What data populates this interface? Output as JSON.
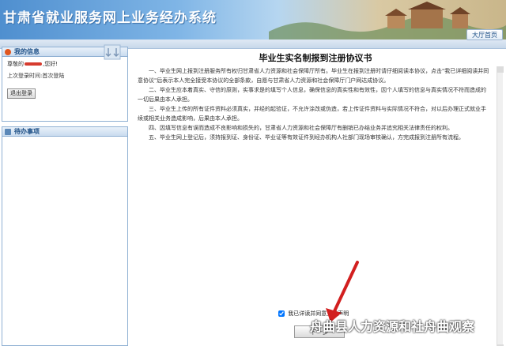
{
  "header": {
    "title": "甘肃省就业服务网上业务经办系统",
    "hall_button": "大厅首页"
  },
  "info_panel": {
    "title": "我的信息",
    "greeting_prefix": "尊敬的",
    "greeting_suffix": ",您好!",
    "last_login_label": "上次登录时间:首次登陆",
    "logout_button": "退出登录"
  },
  "todo_panel": {
    "title": "待办事项"
  },
  "agreement": {
    "title": "毕业生实名制报到注册协议书",
    "paragraphs": [
      "一、毕业生网上报到注册服务所有权归甘肃省人力资源和社会保障厅所有。毕业生在报到注册时请仔细阅读本协议，点击\"我已详细阅读并同意协议\"后表示本人完全接受本协议的全部条款，自愿与甘肃省人力资源和社会保障厅门户网达成协议。",
      "二、毕业生应本着真实、守信的原则，实事求是的填写个人信息，确保信息的真实性和有效性，因个人填写的信息与真实情况不符而造成的一切后果由本人承担。",
      "三、毕业生上传的所有证件资料必须真实，并经的起验证，不允许涂改或伪造，若上传证件资料与实际情况不符合，对以后办理正式就业手续或相关业务造成影响，后果由本人承担。",
      "四、因填写信息有误而造成不良影响和损失的，甘肃省人力资源和社会保障厅有删销已办结业务并追究相关法律责任的权利。",
      "五、毕业生网上登记后，须持报到证、身份证、毕业证等有效证件到经办机构人社部门现场审核确认，方完成报到注册所有流程。"
    ],
    "agree_checkbox_label": "我已详读并同意上述声明",
    "agree_checked": true,
    "next_button": "下一步"
  },
  "watermark": "舟曲县人力资源和社舟曲观察",
  "colors": {
    "accent": "#1d4f86",
    "panel_border": "#8fb0d3",
    "arrow": "#d21f1f"
  }
}
